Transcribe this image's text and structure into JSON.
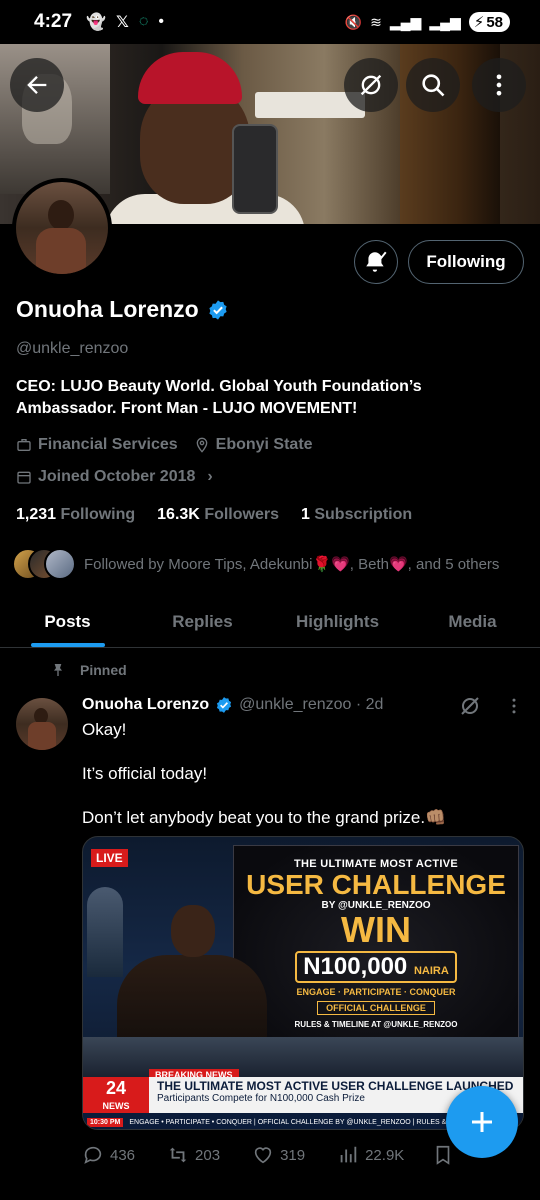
{
  "status_bar": {
    "time": "4:27",
    "battery": "58"
  },
  "profile": {
    "name": "Onuoha Lorenzo",
    "handle": "@unkle_renzoo",
    "bio": "CEO: LUJO Beauty World. Global Youth Foundation’s Ambassador. Front Man - LUJO MOVEMENT!",
    "category": "Financial Services",
    "location": "Ebonyi State",
    "joined": "Joined October 2018",
    "following_button": "Following",
    "stats": {
      "following_count": "1,231",
      "following_label": "Following",
      "followers_count": "16.3K",
      "followers_label": "Followers",
      "subscription_count": "1",
      "subscription_label": "Subscription"
    },
    "followed_by": "Followed by Moore Tips, Adekunbi🌹💗, Beth💗, and 5 others"
  },
  "tabs": [
    "Posts",
    "Replies",
    "Highlights",
    "Media"
  ],
  "post": {
    "pinned_label": "Pinned",
    "author": "Onuoha Lorenzo",
    "meta": "@unkle_renzoo · 2d",
    "lines": [
      "Okay!",
      "It’s official today!",
      "Don’t let anybody beat you to the grand prize.👊🏽"
    ],
    "media": {
      "live": "LIVE",
      "line1": "THE ULTIMATE MOST ACTIVE",
      "line2": "USER CHALLENGE",
      "line3": "BY @UNKLE_RENZOO",
      "line4": "WIN",
      "amount": "N100,000",
      "amount_unit": "NAIRA",
      "tagline": "ENGAGE · PARTICIPATE · CONQUER",
      "official": "OFFICIAL CHALLENGE",
      "rules": "RULES & TIMELINE AT @UNKLE_RENZOO",
      "breaking": "BREAKING NEWS",
      "channel": "24",
      "channel_sub": "NEWS",
      "headline": "THE ULTIMATE MOST ACTIVE USER CHALLENGE LAUNCHED",
      "subheadline": "Participants Compete for N100,000 Cash Prize",
      "crawl_time": "10:30 PM",
      "crawl": "ENGAGE • PARTICIPATE • CONQUER | OFFICIAL CHALLENGE BY @UNKLE_RENZOO | RULES & TIMELINE AT @UN"
    },
    "replies": "436",
    "reposts": "203",
    "likes": "319",
    "views": "22.9K"
  },
  "colors": {
    "accent": "#1d9bf0",
    "muted": "#71767b",
    "background": "#000000"
  }
}
